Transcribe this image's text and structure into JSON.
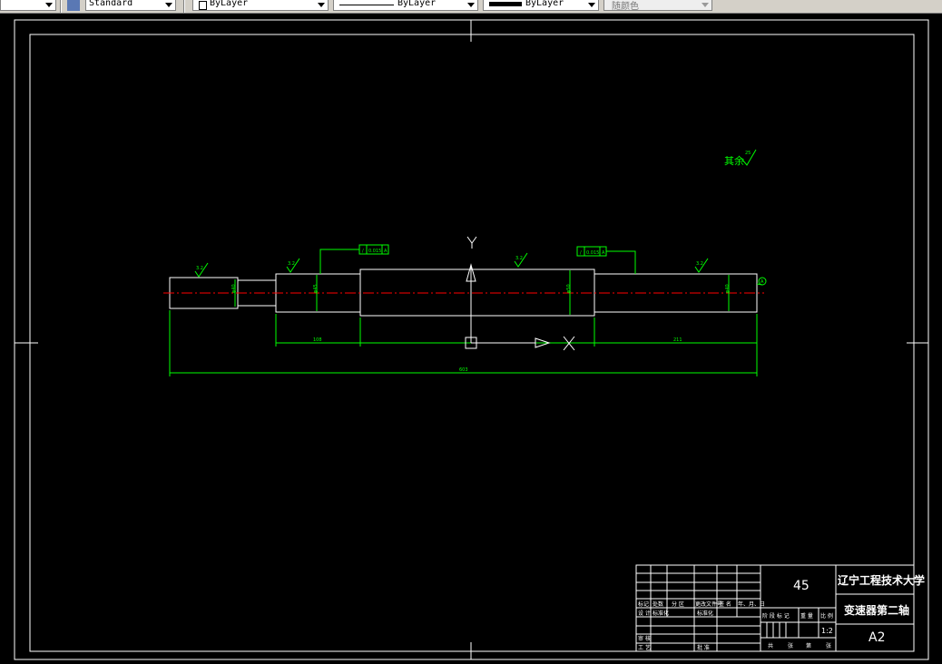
{
  "toolbar": {
    "text_style": "Standard",
    "layer": "ByLayer",
    "linetype": "ByLayer",
    "lineweight": "ByLayer",
    "plot_color": "随颜色"
  },
  "drawing": {
    "roughness_other": "其余",
    "roughness_other_value": "25",
    "roughness_marks": [
      "3.2",
      "3.2",
      "3.2",
      "3.2"
    ],
    "tolerance_1": "0.015",
    "tolerance_2": "0.015",
    "datum_letter": "A",
    "ucs_y": "Y",
    "ucs_x": "X",
    "dim_108": "108",
    "dim_211": "211",
    "dim_total": "603",
    "dia_1": "φ40",
    "dia_2": "φ45",
    "dia_3": "φ50",
    "dia_4": "φ40"
  },
  "title_block": {
    "material": "45",
    "school": "辽宁工程技术大学",
    "part_name": "变速器第二轴",
    "sheet_size": "A2",
    "scale": "1:2",
    "row_labels_1": [
      "标记",
      "处数",
      "分 区",
      "更改文件号",
      "签 名",
      "年、月、日"
    ],
    "row_labels_2": [
      "设 计",
      "标准化",
      "",
      "标准化",
      "",
      ""
    ],
    "stage_labels": [
      "阶 段 标 记",
      "重 量",
      "比 例"
    ],
    "audit": "审 核",
    "process": "工 艺",
    "approve": "批 准",
    "sheets": [
      "共",
      "张",
      "第",
      "张"
    ]
  },
  "colors": {
    "outline": "#ffffff",
    "dimension": "#00ff00",
    "centerline": "#ff0000"
  }
}
